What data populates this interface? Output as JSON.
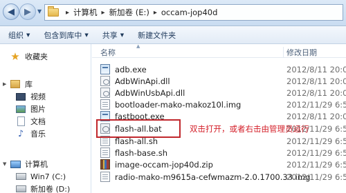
{
  "address": {
    "crumbs": [
      "计算机",
      "新加卷 (E:)",
      "occam-jop40d"
    ]
  },
  "toolbar": {
    "organize": "组织",
    "include_in_library": "包含到库中",
    "share": "共享",
    "new_folder": "新建文件夹"
  },
  "nav": {
    "favorites": "收藏夹",
    "libraries": "库",
    "lib_items": [
      "视频",
      "图片",
      "文档",
      "音乐"
    ],
    "computer": "计算机",
    "drives": [
      "Win7 (C:)",
      "新加卷 (D:)"
    ]
  },
  "columns": {
    "name": "名称",
    "date": "修改日期"
  },
  "files": [
    {
      "name": "adb.exe",
      "date": "2012/8/11 20:07",
      "type": "exe"
    },
    {
      "name": "AdbWinApi.dll",
      "date": "2012/8/11 20:07",
      "type": "dll"
    },
    {
      "name": "AdbWinUsbApi.dll",
      "date": "2012/8/11 20:07",
      "type": "dll"
    },
    {
      "name": "bootloader-mako-makoz10l.img",
      "date": "2012/11/29 6:51",
      "type": "img"
    },
    {
      "name": "fastboot.exe",
      "date": "2012/8/11 20:07",
      "type": "exe"
    },
    {
      "name": "flash-all.bat",
      "date": "2012/11/29 6:51",
      "type": "bat"
    },
    {
      "name": "flash-all.sh",
      "date": "2012/11/29 6:51",
      "type": "sh"
    },
    {
      "name": "flash-base.sh",
      "date": "2012/11/29 6:51",
      "type": "sh"
    },
    {
      "name": "image-occam-jop40d.zip",
      "date": "2012/11/29 6:51",
      "type": "zip"
    },
    {
      "name": "radio-mako-m9615a-cefwmazm-2.0.1700.33.img",
      "date": "2012/11/29 6:51",
      "type": "img"
    }
  ],
  "annotation": "双击打开，或者右击由管理员运行",
  "colors": {
    "annotation": "#d4202a",
    "highlight_border": "#c0262b",
    "chrome": "#dce9f7"
  }
}
